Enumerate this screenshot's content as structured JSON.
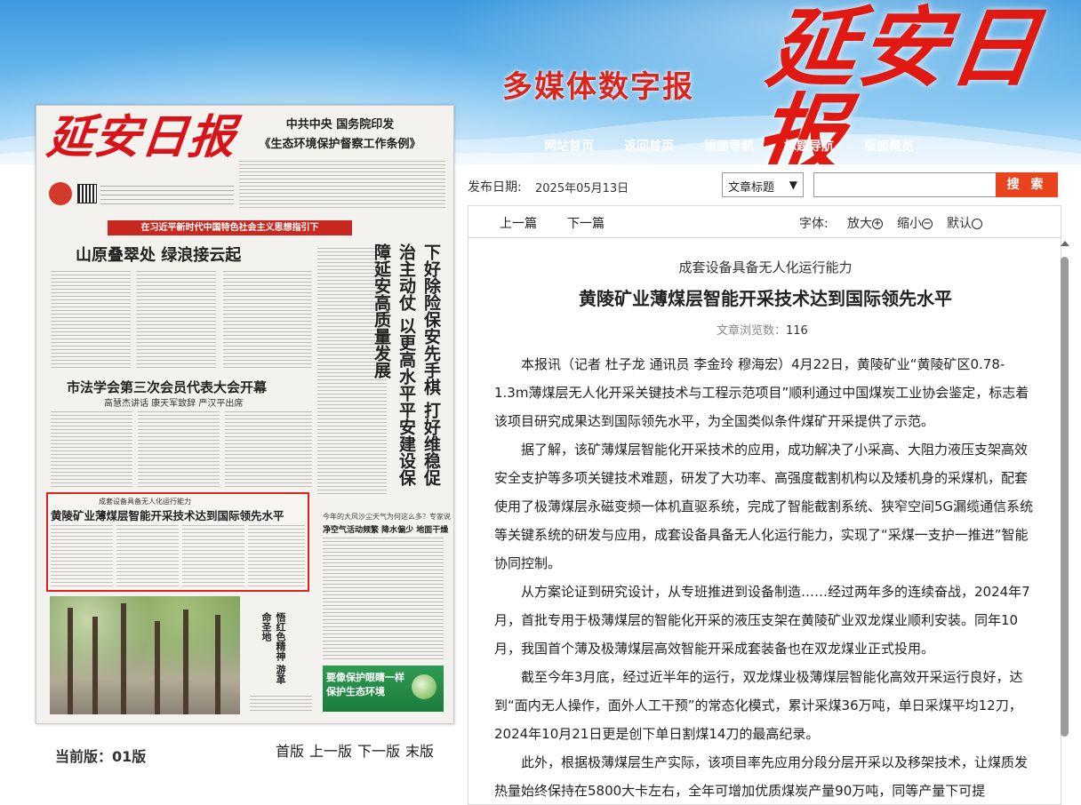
{
  "header": {
    "tagline": "多媒体数字报",
    "logo": "延安日报",
    "nav": [
      "网站首页",
      "返回首页",
      "版面导航",
      "标题导航",
      "版面概览"
    ]
  },
  "paper": {
    "logo": "延安日报",
    "top_story_line1": "中共中央 国务院印发",
    "top_story_line2": "《生态环境保护督察工作条例》",
    "red_banner": "在习近平新时代中国特色社会主义思想指引下",
    "headline1": "山原叠翠处 绿浪接云起",
    "headline2": "市法学会第三次会员代表大会开幕",
    "headline2_sub": "高慧杰讲话 康天军致辞 严汉平出席",
    "vertical_headline": "下好除险保安先手棋 打好维稳促治主动仗 以更高水平平安建设保障延安高质量发展",
    "highlight_sub": "成套设备具备无人化运行能力",
    "highlight_title": "黄陵矿业薄煤层智能开采技术达到国际领先水平",
    "right_small_1": "今年的大风沙尘天气为何这么多？专家说——",
    "right_small_2": "净空气活动频繁 降水偏少 地面干燥",
    "photo_caption": "悟红色精神 游革命圣地",
    "ad_line1": "要像保护眼睛一样",
    "ad_line2": "保护生态环境",
    "current_page": "当前版：01版",
    "page_nav": [
      "首版",
      "上一版",
      "下一版",
      "末版"
    ]
  },
  "meta": {
    "pubdate_label": "发布日期:",
    "pubdate_value": "2025年05月13日",
    "search_select": "文章标题",
    "search_button": "搜 索"
  },
  "toolbar": {
    "prev": "上一篇",
    "next": "下一篇",
    "font_label": "字体:",
    "zoom_in": "放大",
    "zoom_out": "缩小",
    "default": "默认"
  },
  "article": {
    "subtitle": "成套设备具备无人化运行能力",
    "title": "黄陵矿业薄煤层智能开采技术达到国际领先水平",
    "views_label": "文章浏览数：",
    "views": "116",
    "paragraphs": [
      "本报讯（记者 杜子龙 通讯员 李金玲 穆海宏）4月22日，黄陵矿业“黄陵矿区0.78-1.3m薄煤层无人化开采关键技术与工程示范项目”顺利通过中国煤炭工业协会鉴定，标志着该项目研究成果达到国际领先水平，为全国类似条件煤矿开采提供了示范。",
      "据了解，该矿薄煤层智能化开采技术的应用，成功解决了小采高、大阻力液压支架高效安全支护等多项关键技术难题，研发了大功率、高强度截割机构以及矮机身的采煤机，配套使用了极薄煤层永磁变频一体机直驱系统，完成了智能截割系统、狭窄空间5G漏缆通信系统等关键系统的研发与应用，成套设备具备无人化运行能力，实现了“采煤一支护一推进”智能协同控制。",
      "从方案论证到研究设计，从专班推进到设备制造……经过两年多的连续奋战，2024年7月，首批专用于极薄煤层的智能化开采的液压支架在黄陵矿业双龙煤业顺利安装。同年10月，我国首个薄及极薄煤层高效智能开采成套装备也在双龙煤业正式投用。",
      "截至今年3月底，经过近半年的运行，双龙煤业极薄煤层智能化高效开采运行良好，达到“面内无人操作，面外人工干预”的常态化模式，累计采煤36万吨，单日采煤平均12刀，2024年10月21日更是创下单日割煤14刀的最高纪录。",
      "此外，根据极薄煤层生产实际，该项目率先应用分段分层开采以及移架技术，让煤质发热量始终保持在5800大卡左右，全年可增加优质煤炭产量90万吨，同等产量下可提"
    ]
  }
}
